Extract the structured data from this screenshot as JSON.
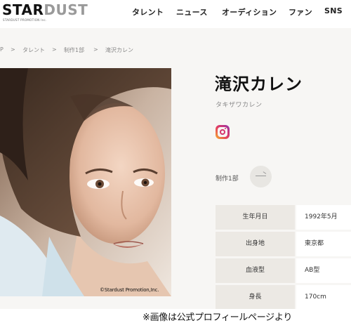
{
  "header": {
    "logo_main_a": "STAR",
    "logo_main_b": "DUST",
    "logo_sub": "STARDUST PROMOTION Inc.",
    "nav": [
      "タレント",
      "ニュース",
      "オーディション",
      "ファン",
      "SNS"
    ]
  },
  "breadcrumb": {
    "items": [
      "P",
      "タレント",
      "制作1部",
      "滝沢カレン"
    ],
    "separator": ">"
  },
  "photo": {
    "credit": "©Stardust Promotion,Inc."
  },
  "profile": {
    "name": "滝沢カレン",
    "name_kana": "タキザワカレン",
    "social_icon": "instagram-icon",
    "department": "制作1部",
    "rows": [
      {
        "label": "生年月日",
        "value": "1992年5月"
      },
      {
        "label": "出身地",
        "value": "東京都"
      },
      {
        "label": "血液型",
        "value": "AB型"
      },
      {
        "label": "身長",
        "value": "170cm"
      }
    ]
  },
  "caption": "※画像は公式プロフィールページより",
  "colors": {
    "background": "#f7f6f4",
    "label_cell": "#ece9e4",
    "value_cell": "#ffffff",
    "text": "#222222",
    "muted_text": "#888888"
  }
}
